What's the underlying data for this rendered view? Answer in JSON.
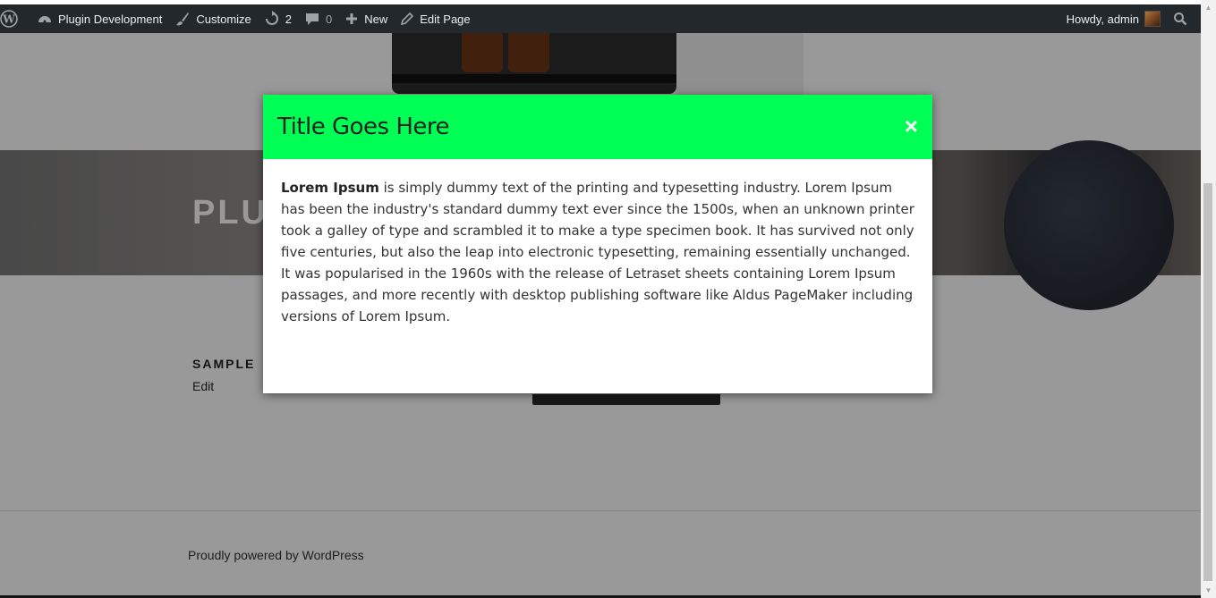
{
  "adminbar": {
    "site_name": "Plugin Development",
    "customize": "Customize",
    "updates_count": "2",
    "comments_count": "0",
    "new_label": "New",
    "edit_page": "Edit Page",
    "howdy": "Howdy, admin"
  },
  "page": {
    "site_title": "PLU",
    "entry_title": "SAMPLE",
    "edit_link": "Edit",
    "footer": "Proudly powered by WordPress"
  },
  "modal": {
    "title": "Title Goes Here",
    "close": "×",
    "body_bold": "Lorem Ipsum",
    "body_text": " is simply dummy text of the printing and typesetting industry. Lorem Ipsum has been the industry's standard dummy text ever since the 1500s, when an unknown printer took a galley of type and scrambled it to make a type specimen book. It has survived not only five centuries, but also the leap into electronic typesetting, remaining essentially unchanged. It was popularised in the 1960s with the release of Letraset sheets containing Lorem Ipsum passages, and more recently with desktop publishing software like Aldus PageMaker including versions of Lorem Ipsum.",
    "header_color": "#00ff55"
  },
  "icons": {
    "wp": "wordpress-logo-icon",
    "dashboard": "dashboard-icon",
    "customize": "brush-icon",
    "updates": "updates-icon",
    "comments": "comment-icon",
    "new": "plus-icon",
    "edit": "pencil-icon",
    "search": "search-icon"
  }
}
